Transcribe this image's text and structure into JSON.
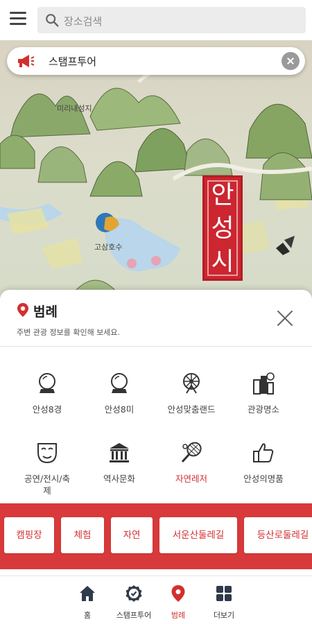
{
  "search": {
    "placeholder": "장소검색"
  },
  "map": {
    "labels": {
      "temple": "미리내성지",
      "lake": "고삼호수"
    },
    "seal_chars": [
      "안",
      "성",
      "시"
    ]
  },
  "stamp_banner": {
    "text": "스탬프투어",
    "icon": "megaphone-icon"
  },
  "sheet": {
    "title": "범례",
    "subtitle": "주변 관광 정보를 확인해 보세요.",
    "grid": [
      {
        "label": "안성8경",
        "icon": "crystal-ball-icon",
        "active": false
      },
      {
        "label": "안성8미",
        "icon": "crystal-ball-icon",
        "active": false
      },
      {
        "label": "안성맞춤랜드",
        "icon": "ferris-wheel-icon",
        "active": false
      },
      {
        "label": "관광명소",
        "icon": "city-landmark-icon",
        "active": false
      },
      {
        "label": "공연/전시/축제",
        "label_lines": [
          "공연/전시/축",
          "제"
        ],
        "icon": "theater-mask-icon",
        "active": false
      },
      {
        "label": "역사문화",
        "icon": "museum-icon",
        "active": false
      },
      {
        "label": "자연레저",
        "icon": "tennis-racket-icon",
        "active": true
      },
      {
        "label": "안성의명품",
        "icon": "thumbs-up-icon",
        "active": false
      }
    ]
  },
  "chips": [
    "캠핑장",
    "체험",
    "자연",
    "서운산둘레길",
    "등산로둘레길"
  ],
  "bottom_nav": [
    {
      "label": "홈",
      "icon": "home-icon",
      "active": false
    },
    {
      "label": "스탬프투어",
      "icon": "stamp-badge-icon",
      "active": false
    },
    {
      "label": "범례",
      "icon": "map-pin-icon",
      "active": true
    },
    {
      "label": "더보기",
      "icon": "grid-more-icon",
      "active": false
    }
  ],
  "colors": {
    "accent": "#d32f2f",
    "chip_strip": "#d8393a",
    "seal": "#cc2630"
  }
}
